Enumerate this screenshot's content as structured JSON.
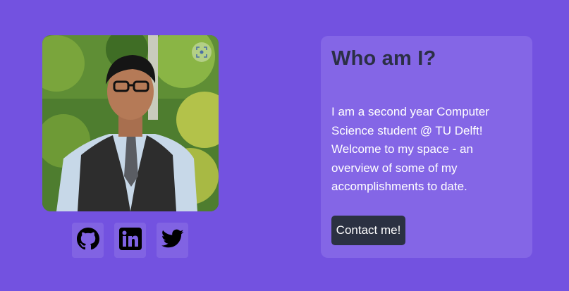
{
  "profile": {
    "photo_alt": "Profile photo",
    "lens_icon": "scan-icon"
  },
  "social": [
    {
      "name": "GitHub",
      "icon": "github-icon"
    },
    {
      "name": "LinkedIn",
      "icon": "linkedin-icon"
    },
    {
      "name": "Twitter",
      "icon": "twitter-icon"
    }
  ],
  "about": {
    "title": "Who am I?",
    "description": "I am a second year Computer Science student @ TU Delft! Welcome to my space - an overview of some of my accomplishments to date.",
    "contact_label": "Contact me!"
  },
  "colors": {
    "background": "#7352e0",
    "card": "#8466e6",
    "title": "#2b2f45",
    "button": "#2b3142"
  }
}
